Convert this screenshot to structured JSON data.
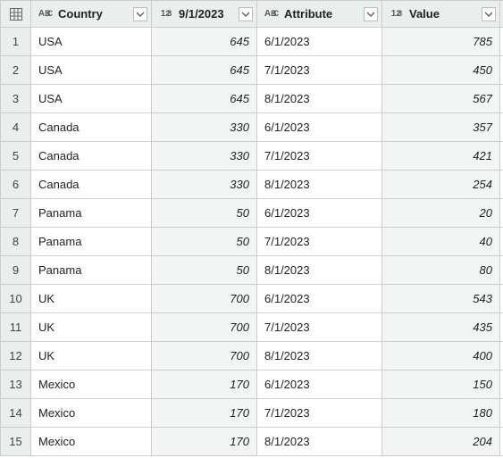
{
  "columns": {
    "country": {
      "label": "Country",
      "type": "text"
    },
    "sep1": {
      "label": "9/1/2023",
      "type": "number"
    },
    "attr": {
      "label": "Attribute",
      "type": "text"
    },
    "value": {
      "label": "Value",
      "type": "number"
    }
  },
  "type_glyphs": {
    "text": "ABC",
    "number": "123"
  },
  "rows": [
    {
      "country": "USA",
      "sep1": "645",
      "attr": "6/1/2023",
      "value": "785"
    },
    {
      "country": "USA",
      "sep1": "645",
      "attr": "7/1/2023",
      "value": "450"
    },
    {
      "country": "USA",
      "sep1": "645",
      "attr": "8/1/2023",
      "value": "567"
    },
    {
      "country": "Canada",
      "sep1": "330",
      "attr": "6/1/2023",
      "value": "357"
    },
    {
      "country": "Canada",
      "sep1": "330",
      "attr": "7/1/2023",
      "value": "421"
    },
    {
      "country": "Canada",
      "sep1": "330",
      "attr": "8/1/2023",
      "value": "254"
    },
    {
      "country": "Panama",
      "sep1": "50",
      "attr": "6/1/2023",
      "value": "20"
    },
    {
      "country": "Panama",
      "sep1": "50",
      "attr": "7/1/2023",
      "value": "40"
    },
    {
      "country": "Panama",
      "sep1": "50",
      "attr": "8/1/2023",
      "value": "80"
    },
    {
      "country": "UK",
      "sep1": "700",
      "attr": "6/1/2023",
      "value": "543"
    },
    {
      "country": "UK",
      "sep1": "700",
      "attr": "7/1/2023",
      "value": "435"
    },
    {
      "country": "UK",
      "sep1": "700",
      "attr": "8/1/2023",
      "value": "400"
    },
    {
      "country": "Mexico",
      "sep1": "170",
      "attr": "6/1/2023",
      "value": "150"
    },
    {
      "country": "Mexico",
      "sep1": "170",
      "attr": "7/1/2023",
      "value": "180"
    },
    {
      "country": "Mexico",
      "sep1": "170",
      "attr": "8/1/2023",
      "value": "204"
    }
  ]
}
